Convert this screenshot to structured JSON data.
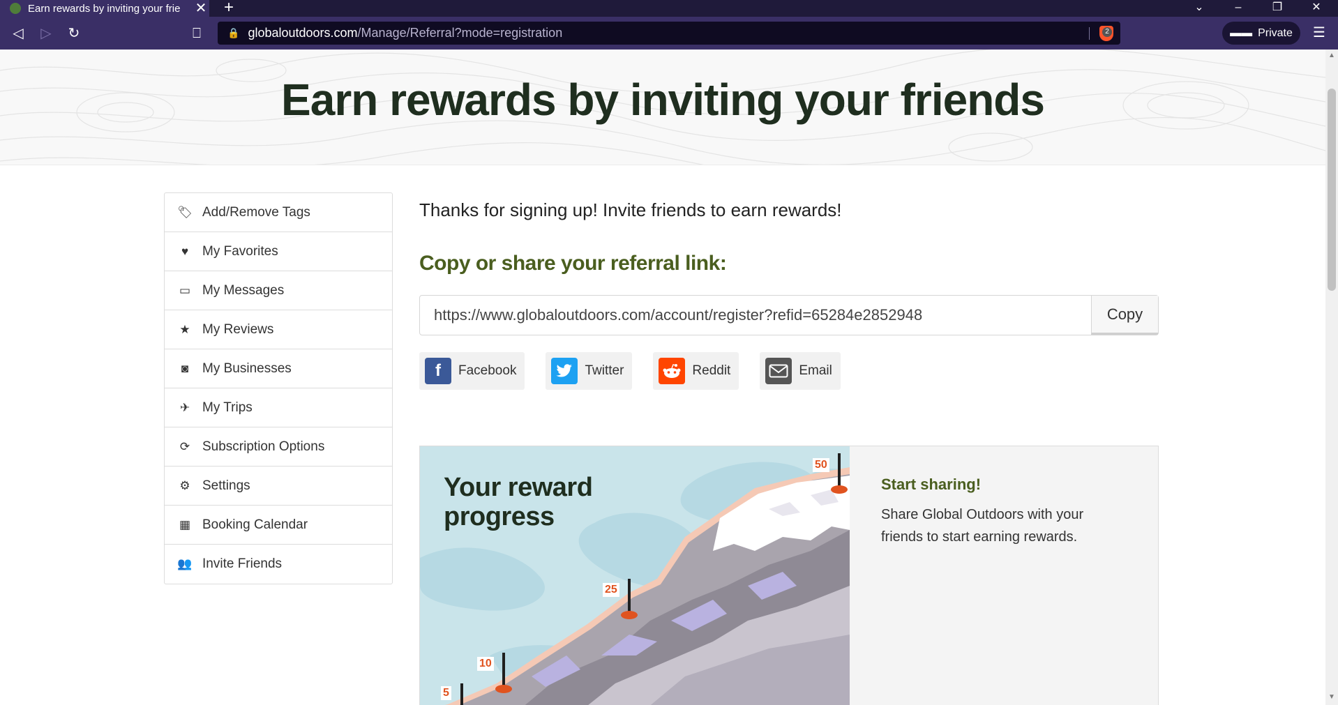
{
  "browser": {
    "tab_title": "Earn rewards by inviting your frie",
    "url_host": "globaloutdoors.com",
    "url_path": "/Manage/Referral?mode=registration",
    "private_label": "Private",
    "brave_badge_count": "2"
  },
  "hero": {
    "title": "Earn rewards by inviting your friends"
  },
  "sidebar": {
    "items": [
      {
        "label": "Add/Remove Tags",
        "icon": "tags-icon"
      },
      {
        "label": "My Favorites",
        "icon": "heart-icon"
      },
      {
        "label": "My Messages",
        "icon": "inbox-icon"
      },
      {
        "label": "My Reviews",
        "icon": "star-icon"
      },
      {
        "label": "My Businesses",
        "icon": "binoculars-icon"
      },
      {
        "label": "My Trips",
        "icon": "plane-icon"
      },
      {
        "label": "Subscription Options",
        "icon": "refresh-icon"
      },
      {
        "label": "Settings",
        "icon": "gear-icon"
      },
      {
        "label": "Booking Calendar",
        "icon": "calendar-icon"
      },
      {
        "label": "Invite Friends",
        "icon": "users-icon"
      }
    ]
  },
  "main": {
    "thanks_text": "Thanks for signing up! Invite friends to earn rewards!",
    "share_heading": "Copy or share your referral link:",
    "referral_link": "https://www.globaloutdoors.com/account/register?refid=65284e2852948",
    "copy_label": "Copy",
    "share_buttons": [
      {
        "label": "Facebook",
        "icon": "facebook-icon",
        "color": "#3b5998"
      },
      {
        "label": "Twitter",
        "icon": "twitter-icon",
        "color": "#1da1f2"
      },
      {
        "label": "Reddit",
        "icon": "reddit-icon",
        "color": "#ff4500"
      },
      {
        "label": "Email",
        "icon": "email-icon",
        "color": "#555555"
      }
    ]
  },
  "reward": {
    "title_line1": "Your reward",
    "title_line2": "progress",
    "milestones": [
      "50",
      "25",
      "10",
      "5"
    ],
    "start_heading": "Start sharing!",
    "start_text": "Share Global Outdoors with your friends to start earning rewards."
  },
  "colors": {
    "heading_green": "#4a5e1f",
    "hero_text": "#1f2e1f",
    "chrome_purple": "#3a2f66"
  }
}
